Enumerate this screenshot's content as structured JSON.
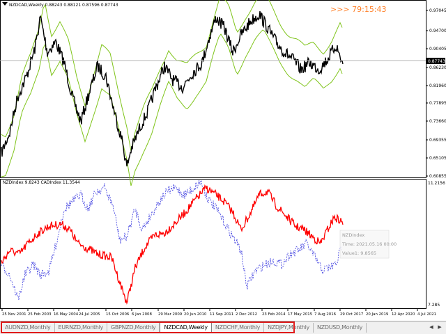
{
  "main_chart": {
    "header": "NZDCAD,Weekly  0.88243 0.88121 0.87596 0.87743",
    "timer": ">>>  79:15:43",
    "current_price_label": "0.87743",
    "price_labels": [
      "0.97045",
      "0.94700",
      "0.90405",
      "0.86230",
      "0.81960",
      "0.77895",
      "0.73660",
      "0.69355",
      "0.65105",
      "0.60855"
    ],
    "colors": {
      "price": "#000000",
      "bands": "#7fc41a",
      "current_line": "#b4b4b4",
      "timer": "#ff7f27"
    }
  },
  "sub_chart": {
    "header": "NZDIndex 9.8243   CADIndex 11.3544",
    "top_value": "11.2156",
    "bottom_value": "7.285",
    "series": [
      {
        "name": "NZDIndex",
        "color": "#ff0000",
        "style": "solid"
      },
      {
        "name": "CADIndex",
        "color": "#3a3adf",
        "style": "dotted"
      }
    ],
    "tooltip": {
      "line1": "NZDIndex",
      "line2": "Time: 2021.05.16 00:00",
      "line3": "Value1: 9.8565"
    }
  },
  "time_axis": [
    "25 Nov 2001",
    "25 Feb 2003",
    "16 May 2004",
    "24 Jul 2005",
    "15 Oct 2006",
    "6 Jan 2008",
    "29 Mar 2009",
    "20 Jun 2010",
    "11 Sep 2011",
    "2 Dec 2012",
    "23 Feb 2014",
    "17 May 2015",
    "7 Aug 2016",
    "29 Oct 2017",
    "20 Jan 2019",
    "12 Apr 2020",
    "4 Jul 2021"
  ],
  "tabs": [
    {
      "label": "AUDNZD,Monthly"
    },
    {
      "label": "EURNZD,Monthly"
    },
    {
      "label": "GBPNZD,Monthly"
    },
    {
      "label": "NZDCAD,Weekly",
      "active": true
    },
    {
      "label": "NZDCHF,Monthly"
    },
    {
      "label": "NZDJPY,Monthly"
    },
    {
      "label": "NZDUSD,Monthly"
    }
  ],
  "tab_scroll": {
    "left": "◀",
    "right": "▶"
  }
}
